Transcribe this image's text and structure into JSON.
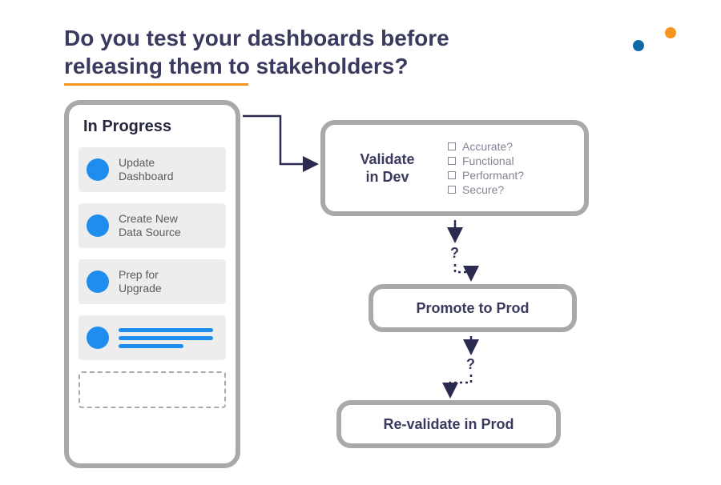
{
  "heading": "Do you test your dashboards before releasing them to stakeholders?",
  "panel": {
    "title": "In Progress",
    "items": [
      "Update\nDashboard",
      "Create New\nData Source",
      "Prep for\nUpgrade"
    ]
  },
  "validate": {
    "title": "Validate\nin Dev",
    "checks": [
      "Accurate?",
      "Functional",
      "Performant?",
      "Secure?"
    ]
  },
  "promote": "Promote to Prod",
  "revalidate": "Re-validate in Prod",
  "q1": "?",
  "q2": "?",
  "colors": {
    "accentBlue": "#1f8ded",
    "darkNavy": "#3a3a5f",
    "orange": "#f7941d",
    "boxBorder": "#a7a9ab"
  }
}
